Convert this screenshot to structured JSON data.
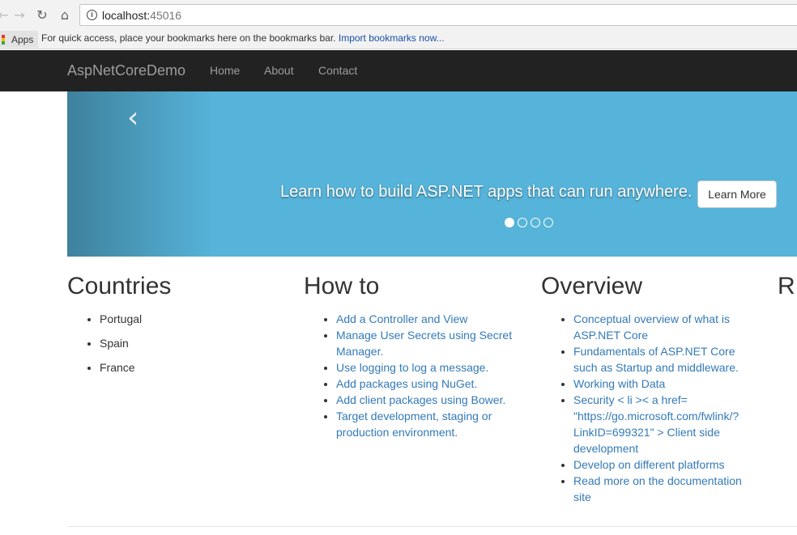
{
  "browser": {
    "back_glyph": "←",
    "forward_glyph": "→",
    "reload_glyph": "↻",
    "home_glyph": "⌂",
    "url_host": "localhost:",
    "url_port": "45016",
    "apps_label": "Apps",
    "bookmarks_hint": "For quick access, place your bookmarks here on the bookmarks bar.",
    "import_link": "Import bookmarks now..."
  },
  "navbar": {
    "brand": "AspNetCoreDemo",
    "links": [
      "Home",
      "About",
      "Contact"
    ]
  },
  "carousel": {
    "prev_glyph": "‹",
    "caption": "Learn how to build ASP.NET apps that can run anywhere.",
    "button_label": "Learn More",
    "slide_count": 4,
    "active_index": 0
  },
  "columns": {
    "countries": {
      "title": "Countries",
      "items": [
        "Portugal",
        "Spain",
        "France"
      ]
    },
    "howto": {
      "title": "How to",
      "items": [
        "Add a Controller and View",
        "Manage User Secrets using Secret Manager.",
        "Use logging to log a message.",
        "Add packages using NuGet.",
        "Add client packages using Bower.",
        "Target development, staging or production environment."
      ]
    },
    "overview": {
      "title": "Overview",
      "items": [
        "Conceptual overview of what is ASP.NET Core",
        "Fundamentals of ASP.NET Core such as Startup and middleware.",
        "Working with Data",
        "Security < li >< a href= \"https://go.microsoft.com/fwlink/?LinkID=699321\" > Client side development",
        "Develop on different platforms",
        "Read more on the documentation site"
      ]
    },
    "partial_heading": "R"
  },
  "colors": {
    "navbar_bg": "#222222",
    "carousel_bg": "#56b3d9",
    "link": "#337ab7"
  }
}
